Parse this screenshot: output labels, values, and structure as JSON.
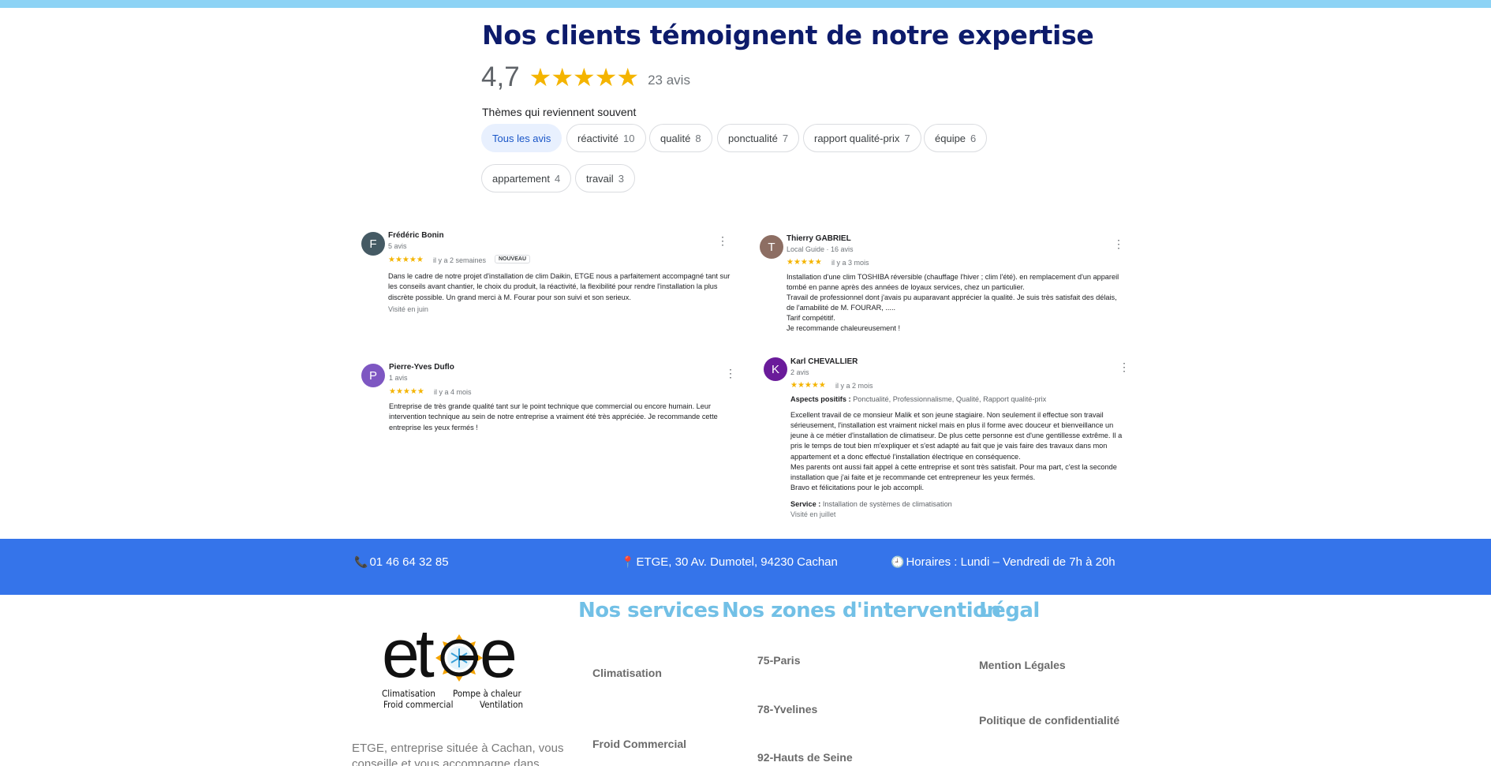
{
  "heading": "Nos clients témoignent de notre expertise",
  "rating": {
    "score": "4,7",
    "stars": "★★★★★",
    "count": "23 avis"
  },
  "themes": {
    "title": "Thèmes qui reviennent souvent",
    "chips": [
      {
        "label": "Tous les avis",
        "count": ""
      },
      {
        "label": "réactivité",
        "count": "10"
      },
      {
        "label": "qualité",
        "count": "8"
      },
      {
        "label": "ponctualité",
        "count": "7"
      },
      {
        "label": "rapport qualité-prix",
        "count": "7"
      },
      {
        "label": "équipe",
        "count": "6"
      },
      {
        "label": "appartement",
        "count": "4"
      },
      {
        "label": "travail",
        "count": "3"
      }
    ]
  },
  "reviews": [
    {
      "initial": "F",
      "avatar_color": "#455a64",
      "name": "Frédéric Bonin",
      "sub": "5 avis",
      "stars": "★★★★★",
      "date": "il y a 2 semaines",
      "badge": "NOUVEAU",
      "text": "Dans le cadre de notre projet d'installation de clim Daikin, ETGE nous a parfaitement accompagné tant sur les conseils avant chantier, le choix du produit, la réactivité, la flexibilité pour rendre l'installation la plus discrète possible. Un grand merci à M. Fourar pour son suivi et son serieux.",
      "visit": "Visité en juin"
    },
    {
      "initial": "T",
      "avatar_color": "#8d6e63",
      "name": "Thierry GABRIEL",
      "sub": "Local Guide · 16 avis",
      "stars": "★★★★★",
      "date": "il y a 3 mois",
      "lines": [
        "Installation d'une clim TOSHIBA réversible (chauffage l'hiver ; clim l'été). en remplacement d'un appareil",
        "tombé en panne après des années de loyaux services, chez un particulier.",
        "Travail de professionnel dont j'avais pu auparavant apprécier la qualité. Je suis très satisfait des délais,",
        "de l'amabilité de M. FOURAR, .....",
        "Tarif compétitif.",
        "Je recommande chaleureusement !"
      ]
    },
    {
      "initial": "P",
      "avatar_color": "#7e57c2",
      "name": "Pierre-Yves Duflo",
      "sub": "1 avis",
      "stars": "★★★★★",
      "date": "il y a 4 mois",
      "text": "Entreprise de très grande qualité tant sur le point technique que commercial ou encore humain. Leur intervention technique au sein de notre entreprise a vraiment été très appréciée. Je recommande cette entreprise les yeux fermés !"
    },
    {
      "initial": "K",
      "avatar_color": "#6a1b9a",
      "name": "Karl CHEVALLIER",
      "sub": "2 avis",
      "stars": "★★★★★",
      "date": "il y a 2 mois",
      "aspects_label": "Aspects positifs :",
      "aspects": "Ponctualité, Professionnalisme, Qualité, Rapport qualité-prix",
      "lines": [
        "Excellent travail de ce monsieur Malik et son jeune stagiaire. Non seulement il effectue son travail",
        "sérieusement, l'installation est vraiment nickel mais en plus il forme avec douceur et bienveillance un",
        "jeune à ce métier d'installation de climatiseur. De plus cette personne est d'une gentillesse extrême. Il a",
        "pris le temps de tout bien m'expliquer et s'est adapté au fait que je vais faire des travaux dans mon",
        "appartement et a donc effectué l'installation électrique en conséquence.",
        "Mes parents ont aussi fait appel à cette entreprise et sont très satisfait. Pour ma part, c'est la seconde",
        "installation que j'ai faite et je recommande cet entrepreneur les yeux fermés.",
        "Bravo et félicitations pour le job accompli."
      ],
      "service_label": "Service :",
      "service": "Installation de systèmes de climatisation",
      "visit": "Visité en juillet"
    }
  ],
  "contact": {
    "phone": "01 46 64 32 85",
    "address": "ETGE, 30 Av. Dumotel, 94230 Cachan",
    "hours": "Horaires : Lundi – Vendredi de 7h à 20h",
    "phone_icon": "phone-icon",
    "address_icon": "pin-icon",
    "hours_icon": "clock-icon"
  },
  "logo": {
    "wordmark": "etGe",
    "tag_left_1": "Climatisation",
    "tag_right_1": "Pompe à chaleur",
    "tag_left_2": "Froid commercial",
    "tag_right_2": "Ventilation"
  },
  "footer": {
    "about": "ETGE, entreprise située à Cachan, vous conseille et vous accompagne dans",
    "services_title": "Nos services",
    "services": [
      "Climatisation",
      "Froid Commercial"
    ],
    "zones_title": "Nos zones d'intervention",
    "zones": [
      "75-Paris",
      "78-Yvelines",
      "92-Hauts de Seine"
    ],
    "legal_title": "Légal",
    "legal": [
      "Mention Légales",
      "Politique de confidentialité"
    ]
  },
  "colors": {
    "top_strip": "#8dd3f5",
    "heading": "#0d1b6b",
    "contact_bar": "#3574ea",
    "footer_titles": "#72c0e6",
    "stars": "#f4b400"
  }
}
